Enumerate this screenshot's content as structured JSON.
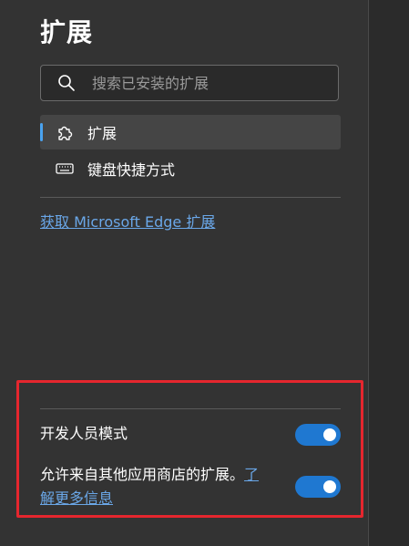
{
  "header": {
    "title": "扩展"
  },
  "search": {
    "placeholder": "搜索已安装的扩展",
    "value": ""
  },
  "nav": {
    "items": [
      {
        "label": "扩展",
        "icon": "puzzle-icon",
        "active": true
      },
      {
        "label": "键盘快捷方式",
        "icon": "keyboard-icon",
        "active": false
      }
    ]
  },
  "links": {
    "get_extensions": "获取 Microsoft Edge 扩展"
  },
  "settings": {
    "developer_mode": {
      "label": "开发人员模式",
      "enabled": true
    },
    "other_stores": {
      "label": "允许来自其他应用商店的扩展。",
      "link_part1": "了",
      "link_part2": "解更多信息",
      "enabled": true
    }
  },
  "colors": {
    "accent": "#1f78d1",
    "link": "#6aa7e8",
    "highlight_border": "#e5262e",
    "active_indicator": "#4aa3f0"
  }
}
